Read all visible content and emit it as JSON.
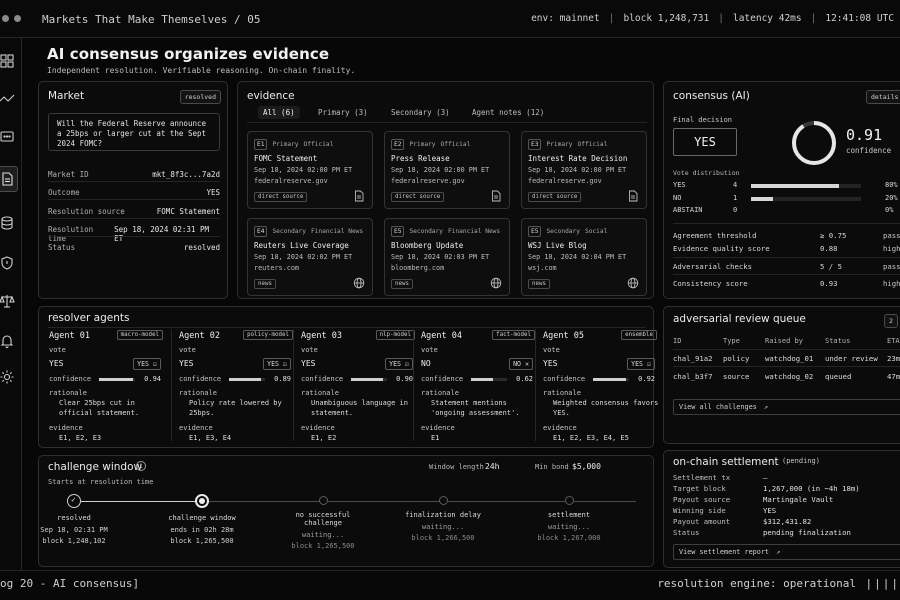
{
  "topbar": {
    "title": "Markets That Make Themselves / 05",
    "env": "env: mainnet",
    "block": "block 1,248,731",
    "latency": "latency 42ms",
    "time": "12:41:08 UTC"
  },
  "sidebar": {
    "icons": [
      "grid-icon",
      "chart-icon",
      "chat-icon",
      "document-icon",
      "database-icon",
      "shield-icon",
      "scale-icon",
      "bell-icon",
      "gear-icon"
    ]
  },
  "header": {
    "title": "AI consensus organizes evidence",
    "subtitle": "Independent resolution. Verifiable reasoning. On-chain finality."
  },
  "market": {
    "title": "Market",
    "status_badge": "resolved",
    "question": "Will the Federal Reserve announce a 25bps or larger cut at the Sept 2024 FOMC?",
    "fields": [
      {
        "k": "Market ID",
        "v": "mkt_8f3c...7a2d"
      },
      {
        "k": "Outcome",
        "v": "YES"
      },
      {
        "k": "Resolution source",
        "v": "FOMC Statement"
      },
      {
        "k": "Resolution time",
        "v": "Sep 18, 2024 02:31 PM ET"
      },
      {
        "k": "Status",
        "v": "resolved"
      }
    ]
  },
  "evidence": {
    "title": "evidence",
    "tabs": [
      "All (6)",
      "Primary (3)",
      "Secondary (3)",
      "Agent notes (12)"
    ],
    "cards": [
      {
        "id": "E1",
        "tier": "Primary",
        "kind": "Official",
        "title": "FOMC Statement",
        "date": "Sep 18, 2024 02:00 PM ET",
        "source": "federalreserve.gov",
        "type": "direct source",
        "icon": "document-icon"
      },
      {
        "id": "E2",
        "tier": "Primary",
        "kind": "Official",
        "title": "Press Release",
        "date": "Sep 18, 2024 02:00 PM ET",
        "source": "federalreserve.gov",
        "type": "direct source",
        "icon": "document-icon"
      },
      {
        "id": "E3",
        "tier": "Primary",
        "kind": "Official",
        "title": "Interest Rate Decision",
        "date": "Sep 18, 2024 02:00 PM ET",
        "source": "federalreserve.gov",
        "type": "direct source",
        "icon": "document-icon"
      },
      {
        "id": "E4",
        "tier": "Secondary",
        "kind": "Financial News",
        "title": "Reuters Live Coverage",
        "date": "Sep 18, 2024 02:02 PM ET",
        "source": "reuters.com",
        "type": "news",
        "icon": "globe-icon"
      },
      {
        "id": "E5",
        "tier": "Secondary",
        "kind": "Financial News",
        "title": "Bloomberg Update",
        "date": "Sep 18, 2024 02:03 PM ET",
        "source": "bloomberg.com",
        "type": "news",
        "icon": "globe-icon"
      },
      {
        "id": "E5",
        "tier": "Secondary",
        "kind": "Social",
        "title": "WSJ Live Blog",
        "date": "Sep 18, 2024 02:04 PM ET",
        "source": "wsj.com",
        "type": "news",
        "icon": "globe-icon"
      }
    ]
  },
  "consensus": {
    "title": "consensus (AI)",
    "details_button": "details",
    "final_label": "Final decision",
    "final_value": "YES",
    "confidence_value": "0.91",
    "confidence_fraction": 0.91,
    "confidence_label": "confidence",
    "vote_label": "Vote distribution",
    "votes": [
      {
        "label": "YES",
        "count": "4",
        "fraction": 0.8,
        "pct": "80%"
      },
      {
        "label": "NO",
        "count": "1",
        "fraction": 0.2,
        "pct": "20%"
      },
      {
        "label": "ABSTAIN",
        "count": "0",
        "fraction": 0.0,
        "pct": "0%"
      }
    ],
    "checks": [
      {
        "k": "Agreement threshold",
        "v": "≥ 0.75",
        "s": "pass"
      },
      {
        "k": "Evidence quality score",
        "v": "0.88",
        "s": "high"
      },
      {
        "k": "Adversarial checks",
        "v": "5 / 5",
        "s": "pass"
      },
      {
        "k": "Consistency score",
        "v": "0.93",
        "s": "high"
      }
    ]
  },
  "agents": {
    "title": "resolver agents",
    "vote_label": "vote",
    "confidence_label": "confidence",
    "rationale_label": "rationale",
    "evidence_label": "evidence",
    "list": [
      {
        "name": "Agent 01",
        "model": "macro-model",
        "vote": "YES",
        "vote_badge": "YES",
        "confidence": "0.94",
        "conf_fraction": 0.94,
        "rationale": "Clear 25bps cut in official statement.",
        "evidence": "E1, E2, E3"
      },
      {
        "name": "Agent 02",
        "model": "policy-model",
        "vote": "YES",
        "vote_badge": "YES",
        "confidence": "0.89",
        "conf_fraction": 0.89,
        "rationale": "Policy rate lowered by 25bps.",
        "evidence": "E1, E3, E4"
      },
      {
        "name": "Agent 03",
        "model": "nlp-model",
        "vote": "YES",
        "vote_badge": "YES",
        "confidence": "0.90",
        "conf_fraction": 0.9,
        "rationale": "Unambiguous language in statement.",
        "evidence": "E1, E2"
      },
      {
        "name": "Agent 04",
        "model": "fact-model",
        "vote": "NO",
        "vote_badge": "NO",
        "confidence": "0.62",
        "conf_fraction": 0.62,
        "rationale": "Statement mentions 'ongoing assessment'.",
        "evidence": "E1"
      },
      {
        "name": "Agent 05",
        "model": "ensemble",
        "vote": "YES",
        "vote_badge": "YES",
        "confidence": "0.92",
        "conf_fraction": 0.92,
        "rationale": "Weighted consensus favors YES.",
        "evidence": "E1, E2, E3, E4, E5"
      }
    ]
  },
  "adversarial": {
    "title": "adversarial review queue",
    "count": "2",
    "columns": [
      "ID",
      "Type",
      "Raised by",
      "Status",
      "ETA"
    ],
    "rows": [
      {
        "id": "chal_91a2",
        "type": "policy",
        "by": "watchdog_01",
        "status": "under review",
        "eta": "23m"
      },
      {
        "id": "chal_b3f7",
        "type": "source",
        "by": "watchdog_02",
        "status": "queued",
        "eta": "47m"
      }
    ],
    "view_all": "View all challenges"
  },
  "challenge": {
    "title": "challenge window",
    "subtitle": "Starts at resolution time",
    "window_label": "Window length",
    "window_value": "24h",
    "bond_label": "Min bond",
    "bond_value": "$5,000",
    "steps": [
      {
        "name": "resolved",
        "line1": "Sep 18, 02:31 PM",
        "line2": "block 1,248,102",
        "state": "done"
      },
      {
        "name": "challenge window",
        "line1": "ends in 02h 28m",
        "line2": "block 1,265,500",
        "state": "current"
      },
      {
        "name": "no successful challenge",
        "line1": "waiting...",
        "line2": "block 1,265,500",
        "state": "pending"
      },
      {
        "name": "finalization delay",
        "line1": "waiting...",
        "line2": "block 1,266,500",
        "state": "pending"
      },
      {
        "name": "settlement",
        "line1": "waiting...",
        "line2": "block 1,267,000",
        "state": "pending"
      }
    ]
  },
  "settlement": {
    "title": "on-chain settlement",
    "badge": "(pending)",
    "rows": [
      {
        "k": "Settlement tx",
        "v": "–"
      },
      {
        "k": "Target block",
        "v": "1,267,000 (in ~4h 18m)"
      },
      {
        "k": "Payout source",
        "v": "Martingale Vault"
      },
      {
        "k": "Winning side",
        "v": "YES"
      },
      {
        "k": "Payout amount",
        "v": "$312,431.82"
      },
      {
        "k": "Status",
        "v": "pending finalization"
      }
    ],
    "report_button": "View settlement report"
  },
  "bottombar": {
    "left": "og 20 - AI consensus]",
    "right": "resolution engine: operational",
    "bars": "||||"
  }
}
